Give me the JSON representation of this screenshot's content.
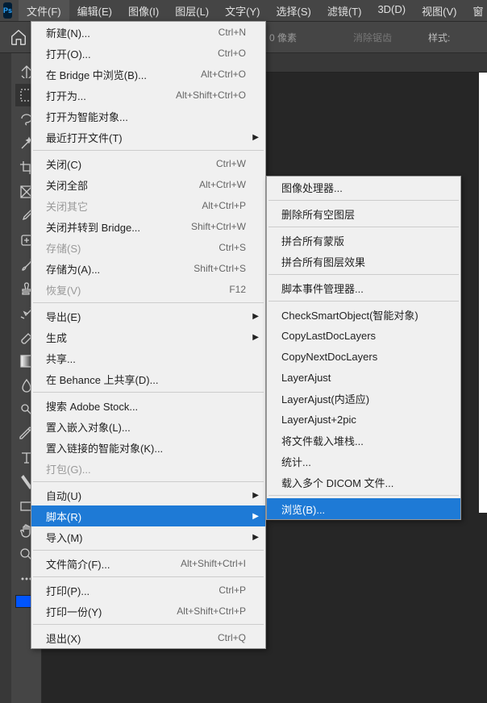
{
  "logo": "Ps",
  "menubar": [
    "文件(F)",
    "编辑(E)",
    "图像(I)",
    "图层(L)",
    "文字(Y)",
    "选择(S)",
    "滤镜(T)",
    "3D(D)",
    "视图(V)",
    "窗"
  ],
  "options": {
    "px": "0 像素",
    "antialias": "消除锯齿",
    "style": "样式:"
  },
  "file_menu": [
    {
      "t": "item",
      "label": "新建(N)...",
      "sc": "Ctrl+N"
    },
    {
      "t": "item",
      "label": "打开(O)...",
      "sc": "Ctrl+O"
    },
    {
      "t": "item",
      "label": "在 Bridge 中浏览(B)...",
      "sc": "Alt+Ctrl+O"
    },
    {
      "t": "item",
      "label": "打开为...",
      "sc": "Alt+Shift+Ctrl+O"
    },
    {
      "t": "item",
      "label": "打开为智能对象..."
    },
    {
      "t": "sub",
      "label": "最近打开文件(T)"
    },
    {
      "t": "sep"
    },
    {
      "t": "item",
      "label": "关闭(C)",
      "sc": "Ctrl+W"
    },
    {
      "t": "item",
      "label": "关闭全部",
      "sc": "Alt+Ctrl+W"
    },
    {
      "t": "item",
      "label": "关闭其它",
      "sc": "Alt+Ctrl+P",
      "disabled": true
    },
    {
      "t": "item",
      "label": "关闭并转到 Bridge...",
      "sc": "Shift+Ctrl+W"
    },
    {
      "t": "item",
      "label": "存储(S)",
      "sc": "Ctrl+S",
      "disabled": true
    },
    {
      "t": "item",
      "label": "存储为(A)...",
      "sc": "Shift+Ctrl+S"
    },
    {
      "t": "item",
      "label": "恢复(V)",
      "sc": "F12",
      "disabled": true
    },
    {
      "t": "sep"
    },
    {
      "t": "sub",
      "label": "导出(E)"
    },
    {
      "t": "sub",
      "label": "生成"
    },
    {
      "t": "item",
      "label": "共享..."
    },
    {
      "t": "item",
      "label": "在 Behance 上共享(D)..."
    },
    {
      "t": "sep"
    },
    {
      "t": "item",
      "label": "搜索 Adobe Stock..."
    },
    {
      "t": "item",
      "label": "置入嵌入对象(L)..."
    },
    {
      "t": "item",
      "label": "置入链接的智能对象(K)..."
    },
    {
      "t": "item",
      "label": "打包(G)...",
      "disabled": true
    },
    {
      "t": "sep"
    },
    {
      "t": "sub",
      "label": "自动(U)"
    },
    {
      "t": "sub",
      "label": "脚本(R)",
      "hl": true
    },
    {
      "t": "sub",
      "label": "导入(M)"
    },
    {
      "t": "sep"
    },
    {
      "t": "item",
      "label": "文件简介(F)...",
      "sc": "Alt+Shift+Ctrl+I"
    },
    {
      "t": "sep"
    },
    {
      "t": "item",
      "label": "打印(P)...",
      "sc": "Ctrl+P"
    },
    {
      "t": "item",
      "label": "打印一份(Y)",
      "sc": "Alt+Shift+Ctrl+P"
    },
    {
      "t": "sep"
    },
    {
      "t": "item",
      "label": "退出(X)",
      "sc": "Ctrl+Q"
    }
  ],
  "scripts_menu": [
    {
      "t": "item",
      "label": "图像处理器..."
    },
    {
      "t": "sep"
    },
    {
      "t": "item",
      "label": "删除所有空图层"
    },
    {
      "t": "sep"
    },
    {
      "t": "item",
      "label": "拼合所有蒙版"
    },
    {
      "t": "item",
      "label": "拼合所有图层效果"
    },
    {
      "t": "sep"
    },
    {
      "t": "item",
      "label": "脚本事件管理器..."
    },
    {
      "t": "sep"
    },
    {
      "t": "item",
      "label": "CheckSmartObject(智能对象)"
    },
    {
      "t": "item",
      "label": "CopyLastDocLayers"
    },
    {
      "t": "item",
      "label": "CopyNextDocLayers"
    },
    {
      "t": "item",
      "label": "LayerAjust"
    },
    {
      "t": "item",
      "label": "LayerAjust(内适应)"
    },
    {
      "t": "item",
      "label": "LayerAjust+2pic"
    },
    {
      "t": "item",
      "label": "将文件载入堆栈..."
    },
    {
      "t": "item",
      "label": "统计..."
    },
    {
      "t": "item",
      "label": "载入多个 DICOM 文件..."
    },
    {
      "t": "sep"
    },
    {
      "t": "item",
      "label": "浏览(B)...",
      "hl": true
    }
  ],
  "tools": [
    "move",
    "marquee",
    "lasso",
    "wand",
    "crop",
    "frame",
    "eyedrop",
    "heal",
    "brush",
    "stamp",
    "history",
    "eraser",
    "gradient",
    "blur",
    "dodge",
    "pen",
    "type",
    "path",
    "rect",
    "hand",
    "zoom",
    "more",
    "swap"
  ]
}
